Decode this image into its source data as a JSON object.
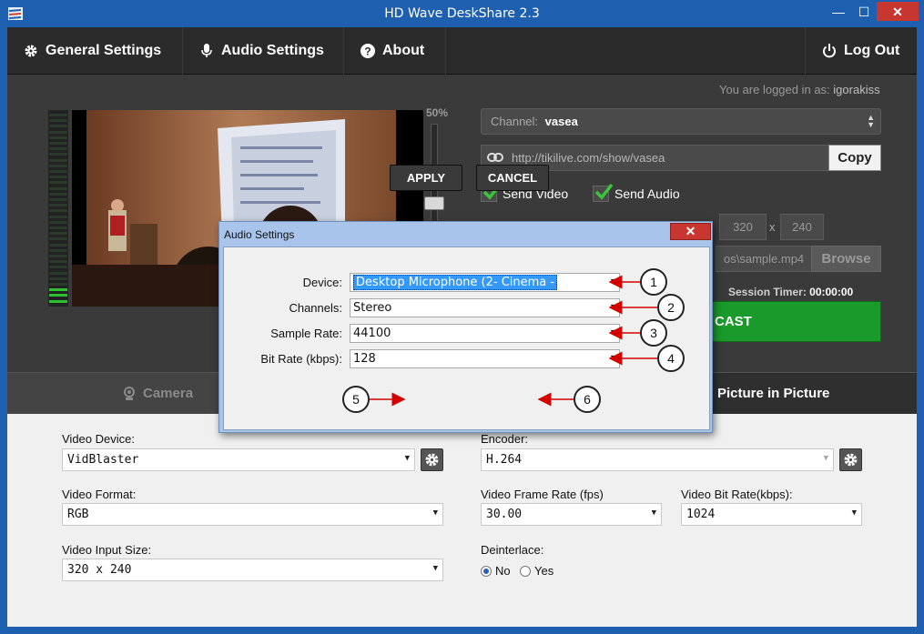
{
  "window": {
    "title": "HD Wave DeskShare 2.3",
    "min": "—",
    "max": "☐",
    "close": "✕"
  },
  "menu": {
    "general": "General Settings",
    "audio": "Audio Settings",
    "about": "About",
    "logout": "Log Out"
  },
  "session": {
    "logged_in_prefix": "You are logged in as:",
    "username": "igorakiss",
    "volume": "50%",
    "channel_prefix": "Channel:",
    "channel": "vasea",
    "url": "http://tikilive.com/show/vasea",
    "copy_label": "Copy",
    "send_video": "Send Video",
    "send_audio": "Send Audio",
    "width": "320",
    "size_sep": "x",
    "height": "240",
    "file": "os\\sample.mp4",
    "browse_label": "Browse",
    "timer_label": "Session Timer:",
    "timer_value": "00:00:00",
    "broadcast_label": "CAST"
  },
  "tabs": {
    "camera": "Camera",
    "pip": "Picture in Picture"
  },
  "settings": {
    "video_device_label": "Video Device:",
    "video_device": "VidBlaster",
    "video_format_label": "Video Format:",
    "video_format": "RGB",
    "video_input_size_label": "Video Input Size:",
    "video_input_size": "320 x 240",
    "encoder_label": "Encoder:",
    "encoder": "H.264",
    "frame_rate_label": "Video Frame Rate (fps)",
    "frame_rate": "30.00",
    "bit_rate_label": "Video Bit Rate(kbps):",
    "bit_rate": "1024",
    "deinterlace_label": "Deinterlace:",
    "deinterlace_no": "No",
    "deinterlace_yes": "Yes"
  },
  "dialog": {
    "title": "Audio Settings",
    "close": "✕",
    "device_label": "Device:",
    "device": "Desktop Microphone (2- Cinema -",
    "channels_label": "Channels:",
    "channels": "Stereo",
    "sample_rate_label": "Sample Rate:",
    "sample_rate": "44100",
    "bit_rate_label": "Bit Rate (kbps):",
    "bit_rate": "128",
    "apply_label": "APPLY",
    "cancel_label": "CANCEL"
  },
  "callouts": [
    "1",
    "2",
    "3",
    "4",
    "5",
    "6"
  ],
  "colors": {
    "titlebar": "#1e5fb0",
    "accent_green": "#1a9a2a",
    "callout_arrow": "#d40000",
    "selection": "#3399ff"
  }
}
